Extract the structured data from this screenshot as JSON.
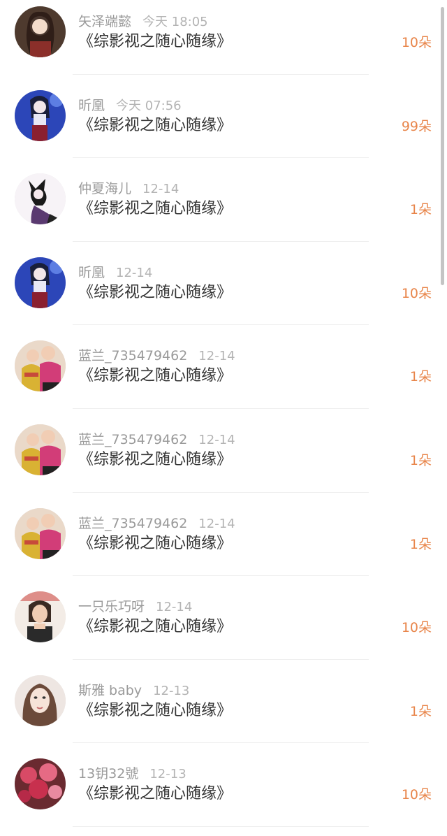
{
  "items": [
    {
      "user": "矢泽端懿",
      "time": "今天 18:05",
      "title": "《综影视之随心随缘》",
      "flowers": "10朵",
      "avatar": "avatar-woman-portrait-icon",
      "avatar_color": "#6b4a3a"
    },
    {
      "user": "昕凰",
      "time": "今天 07:56",
      "title": "《综影视之随心随缘》",
      "flowers": "99朵",
      "avatar": "avatar-anime-girl-icon",
      "avatar_color": "#2b3e9a"
    },
    {
      "user": "仲夏海儿",
      "time": "12-14",
      "title": "《综影视之随心随缘》",
      "flowers": "1朵",
      "avatar": "avatar-anime-sketch-icon",
      "avatar_color": "#f4f0f4"
    },
    {
      "user": "昕凰",
      "time": "12-14",
      "title": "《综影视之随心随缘》",
      "flowers": "10朵",
      "avatar": "avatar-anime-girl-icon",
      "avatar_color": "#2b3e9a"
    },
    {
      "user": "蓝兰_735479462",
      "time": "12-14",
      "title": "《综影视之随心随缘》",
      "flowers": "1朵",
      "avatar": "avatar-children-photo-icon",
      "avatar_color": "#c2506e"
    },
    {
      "user": "蓝兰_735479462",
      "time": "12-14",
      "title": "《综影视之随心随缘》",
      "flowers": "1朵",
      "avatar": "avatar-children-photo-icon",
      "avatar_color": "#c2506e"
    },
    {
      "user": "蓝兰_735479462",
      "time": "12-14",
      "title": "《综影视之随心随缘》",
      "flowers": "1朵",
      "avatar": "avatar-children-photo-icon",
      "avatar_color": "#c2506e"
    },
    {
      "user": "一只乐巧呀",
      "time": "12-14",
      "title": "《综影视之随心随缘》",
      "flowers": "10朵",
      "avatar": "avatar-woman-selfie-icon",
      "avatar_color": "#d9b39a"
    },
    {
      "user": "斯雅 baby",
      "time": "12-13",
      "title": "《综影视之随心随缘》",
      "flowers": "1朵",
      "avatar": "avatar-woman-closeup-icon",
      "avatar_color": "#d8c0b0"
    },
    {
      "user": "13钥32號",
      "time": "12-13",
      "title": "《综影视之随心随缘》",
      "flowers": "10朵",
      "avatar": "avatar-flowers-photo-icon",
      "avatar_color": "#b0304a"
    }
  ],
  "colors": {
    "flower_count": "#e8854a",
    "username": "#9a9a9a",
    "title": "#333333"
  }
}
